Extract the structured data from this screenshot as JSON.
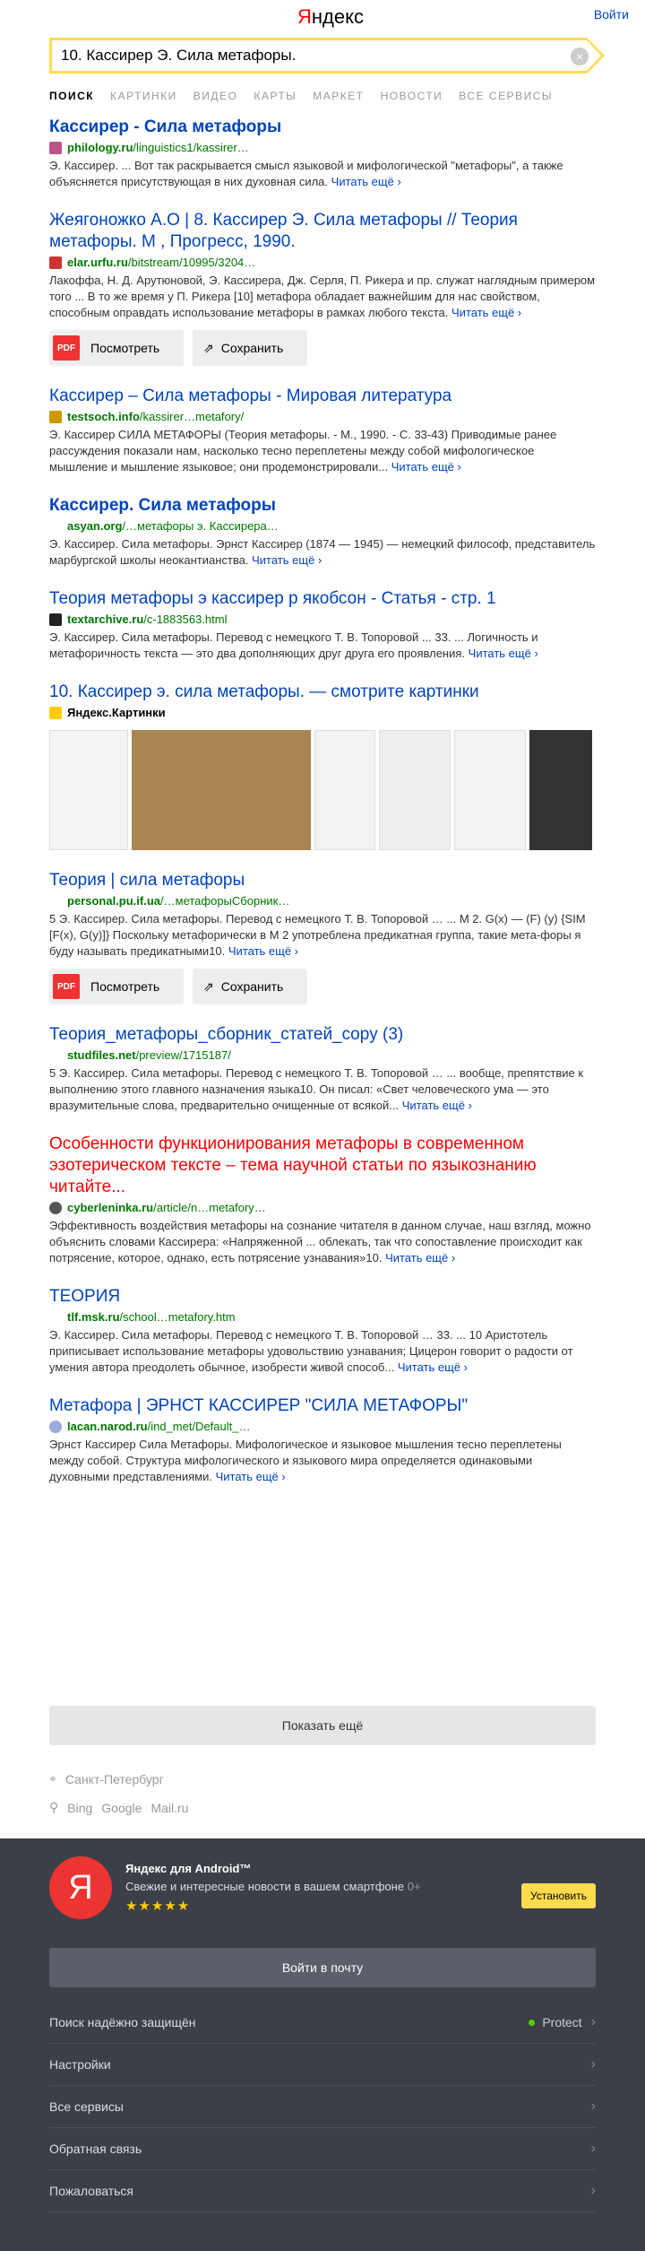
{
  "header": {
    "logo_first": "Я",
    "logo_rest": "ндекс",
    "login": "Войти"
  },
  "search": {
    "value": "10. Кассирер Э. Сила метафоры."
  },
  "tabs": [
    "ПОИСК",
    "КАРТИНКИ",
    "ВИДЕО",
    "КАРТЫ",
    "МАРКЕТ",
    "НОВОСТИ",
    "ВСЕ СЕРВИСЫ"
  ],
  "results": [
    {
      "title": "Кассирер - Сила метафоры",
      "url": "philology.ru",
      "url_rest": "/linguistics1/kassirer…",
      "snippet": "Э. Кассирер. ... Вот так раскрывается смысл языковой и мифологической \"метафоры\", а также объясняется присутствующая в них духовная сила.",
      "more": "Читать ещё ›"
    },
    {
      "title": "Жеягоножко А.О | 8. Кассирер Э. Сила метафоры // Теория метафоры. М , Прогресс, 1990.",
      "url": "elar.urfu.ru",
      "url_rest": "/bitstream/10995/3204…",
      "snippet": "Лакоффа, Н. Д. Арутюновой, Э. Кассирера, Дж. Серля, П. Рикера и пр. служат наглядным примером того ... В то же время у П. Рикера [10] метафора обладает важнейшим для нас свойством, способным оправдать использование метафоры в рамках любого текста.",
      "more": "Читать ещё ›"
    },
    {
      "title": "Кассирер – Сила метафоры - Мировая литература",
      "url": "testsoch.info",
      "url_rest": "/kassirer…metafory/",
      "snippet": "Э. Кассирер СИЛА МЕТАФОРЫ (Теория метафоры. - М., 1990. - С. 33-43) Приводимые ранее рассуждения показали нам, насколько тесно переплетены между собой мифологическое мышление и мышление языковое; они продемонстрировали...",
      "more": "Читать ещё ›"
    },
    {
      "title": "Кассирер. Сила метафоры",
      "url": "asyan.org",
      "url_rest": "/…метафоры э. Кассирера…",
      "snippet": "Э. Кассирер. Сила метафоры. Эрнст Кассирер (1874 — 1945) — немецкий философ, представитель марбургской школы неокантианства.",
      "more": "Читать ещё ›"
    },
    {
      "title": "Теория метафоры э кассирер р якобсон - Статья - стр. 1",
      "url": "textarchive.ru",
      "url_rest": "/c-1883563.html",
      "snippet": "Э. Кассирер. Сила метафоры. Перевод с немецкого Т. В. Топоровой ... 33. ... Логичность и метафоричность текста — это два дополняющих друг друга его проявления.",
      "more": "Читать ещё ›"
    },
    {
      "title": "10. Кассирер э. сила метафоры. — смотрите картинки",
      "url": "Яндекс.Картинки",
      "url_rest": "",
      "snippet": "",
      "more": ""
    },
    {
      "title": "Теория | сила метафоры",
      "url": "personal.pu.if.ua",
      "url_rest": "/…метафорыСборник…",
      "snippet": "5 Э. Кассирер. Сила метафоры. Перевод с немецкого Т. В. Топоровой … ... М 2. G(x) — (F) (y) {SIM [F(x), G(y)]} Поскольку метафорически в M 2 употреблена предикатная группа, такие мета-форы я буду называть предикатными10.",
      "more": "Читать ещё ›"
    },
    {
      "title": "Теория_метафоры_сборник_статей_copy (3)",
      "url": "studfiles.net",
      "url_rest": "/preview/1715187/",
      "snippet": "5 Э. Кассирер. Сила метафоры. Перевод с немецкого Т. В. Топоровой … ... вообще, препятствие к выполнению этого главного назначения языка10. Он писал: «Свет человеческого ума — это вразумительные слова, предварительно очищенные от всякой...",
      "more": "Читать ещё ›"
    },
    {
      "title": "Особенности функционирования метафоры в современном эзотерическом тексте – тема научной статьи по языкознанию читайте...",
      "url": "cyberleninka.ru",
      "url_rest": "/article/n…metafory…",
      "snippet": "Эффективность воздействия метафоры на сознание читателя в данном случае, наш взгляд, можно объяснить словами Кассирера: «Напряженной ... облекать, так что сопоставление происходит как потрясение, которое, однако, есть потрясение узнавания»10.",
      "more": "Читать ещё ›"
    },
    {
      "title": "ТЕОРИЯ",
      "url": "tlf.msk.ru",
      "url_rest": "/school…metafory.htm",
      "snippet": "Э. Кассирер. Сила метафоры. Перевод с немецкого Т. В. Топоровой … 33. ... 10 Аристотель приписывает использование метафоры удовольствию узнавания; Цицерон говорит о радости от умения автора преодолеть обычное, изобрести живой способ...",
      "more": "Читать ещё ›"
    },
    {
      "title": "Метафора | ЭРНСТ КАССИРЕР \"СИЛА МЕТАФОРЫ\"",
      "url": "lacan.narod.ru",
      "url_rest": "/ind_met/Default_…",
      "snippet": "Эрнст Кассирер Сила Метафоры. Мифологическое и языковое мышления тесно переплетены между собой. Структура мифологического и языкового мира определяется одинаковыми духовными представлениями.",
      "more": "Читать ещё ›"
    }
  ],
  "actions": {
    "pdf": "PDF",
    "view": "Посмотреть",
    "save": "Сохранить"
  },
  "showmore": "Показать ещё",
  "geo": "Санкт-Петербург",
  "other_engines": [
    "Bing",
    "Google",
    "Mail.ru"
  ],
  "footer": {
    "app_title": "Яндекс для Android™",
    "app_sub": "Свежие и интересные новости в вашем смартфоне",
    "app_age": "0+",
    "stars": "★★★★★",
    "install": "Установить",
    "mail": "Войти в почту",
    "links": [
      "Поиск надёжно защищён",
      "Настройки",
      "Все сервисы",
      "Обратная связь",
      "Пожаловаться"
    ],
    "protect": "Protect"
  }
}
